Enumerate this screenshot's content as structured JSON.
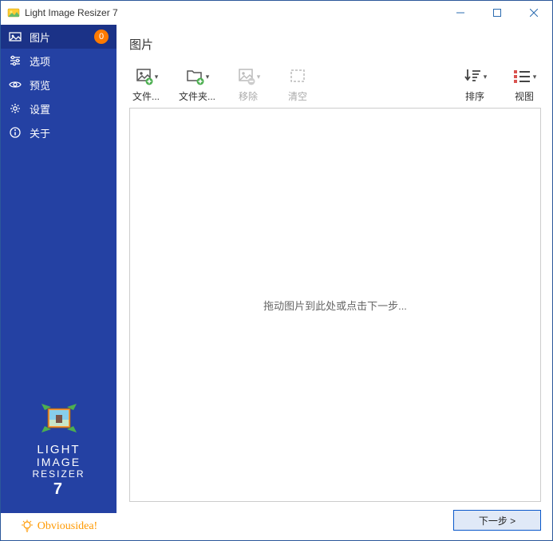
{
  "window": {
    "title": "Light Image Resizer 7"
  },
  "sidebar": {
    "items": [
      {
        "label": "图片",
        "badge": "0"
      },
      {
        "label": "选项"
      },
      {
        "label": "预览"
      },
      {
        "label": "设置"
      },
      {
        "label": "关于"
      }
    ],
    "logo": {
      "line1": "LIGHT",
      "line2": "IMAGE",
      "line3": "RESIZER",
      "line4": "7"
    },
    "footer_brand": "Obviousidea!"
  },
  "main": {
    "title": "图片",
    "toolbar": {
      "files": "文件...",
      "folders": "文件夹...",
      "remove": "移除",
      "clear": "清空",
      "sort": "排序",
      "view": "视图"
    },
    "drop_placeholder": "拖动图片到此处或点击下一步...",
    "next_label": "下一步 >"
  }
}
